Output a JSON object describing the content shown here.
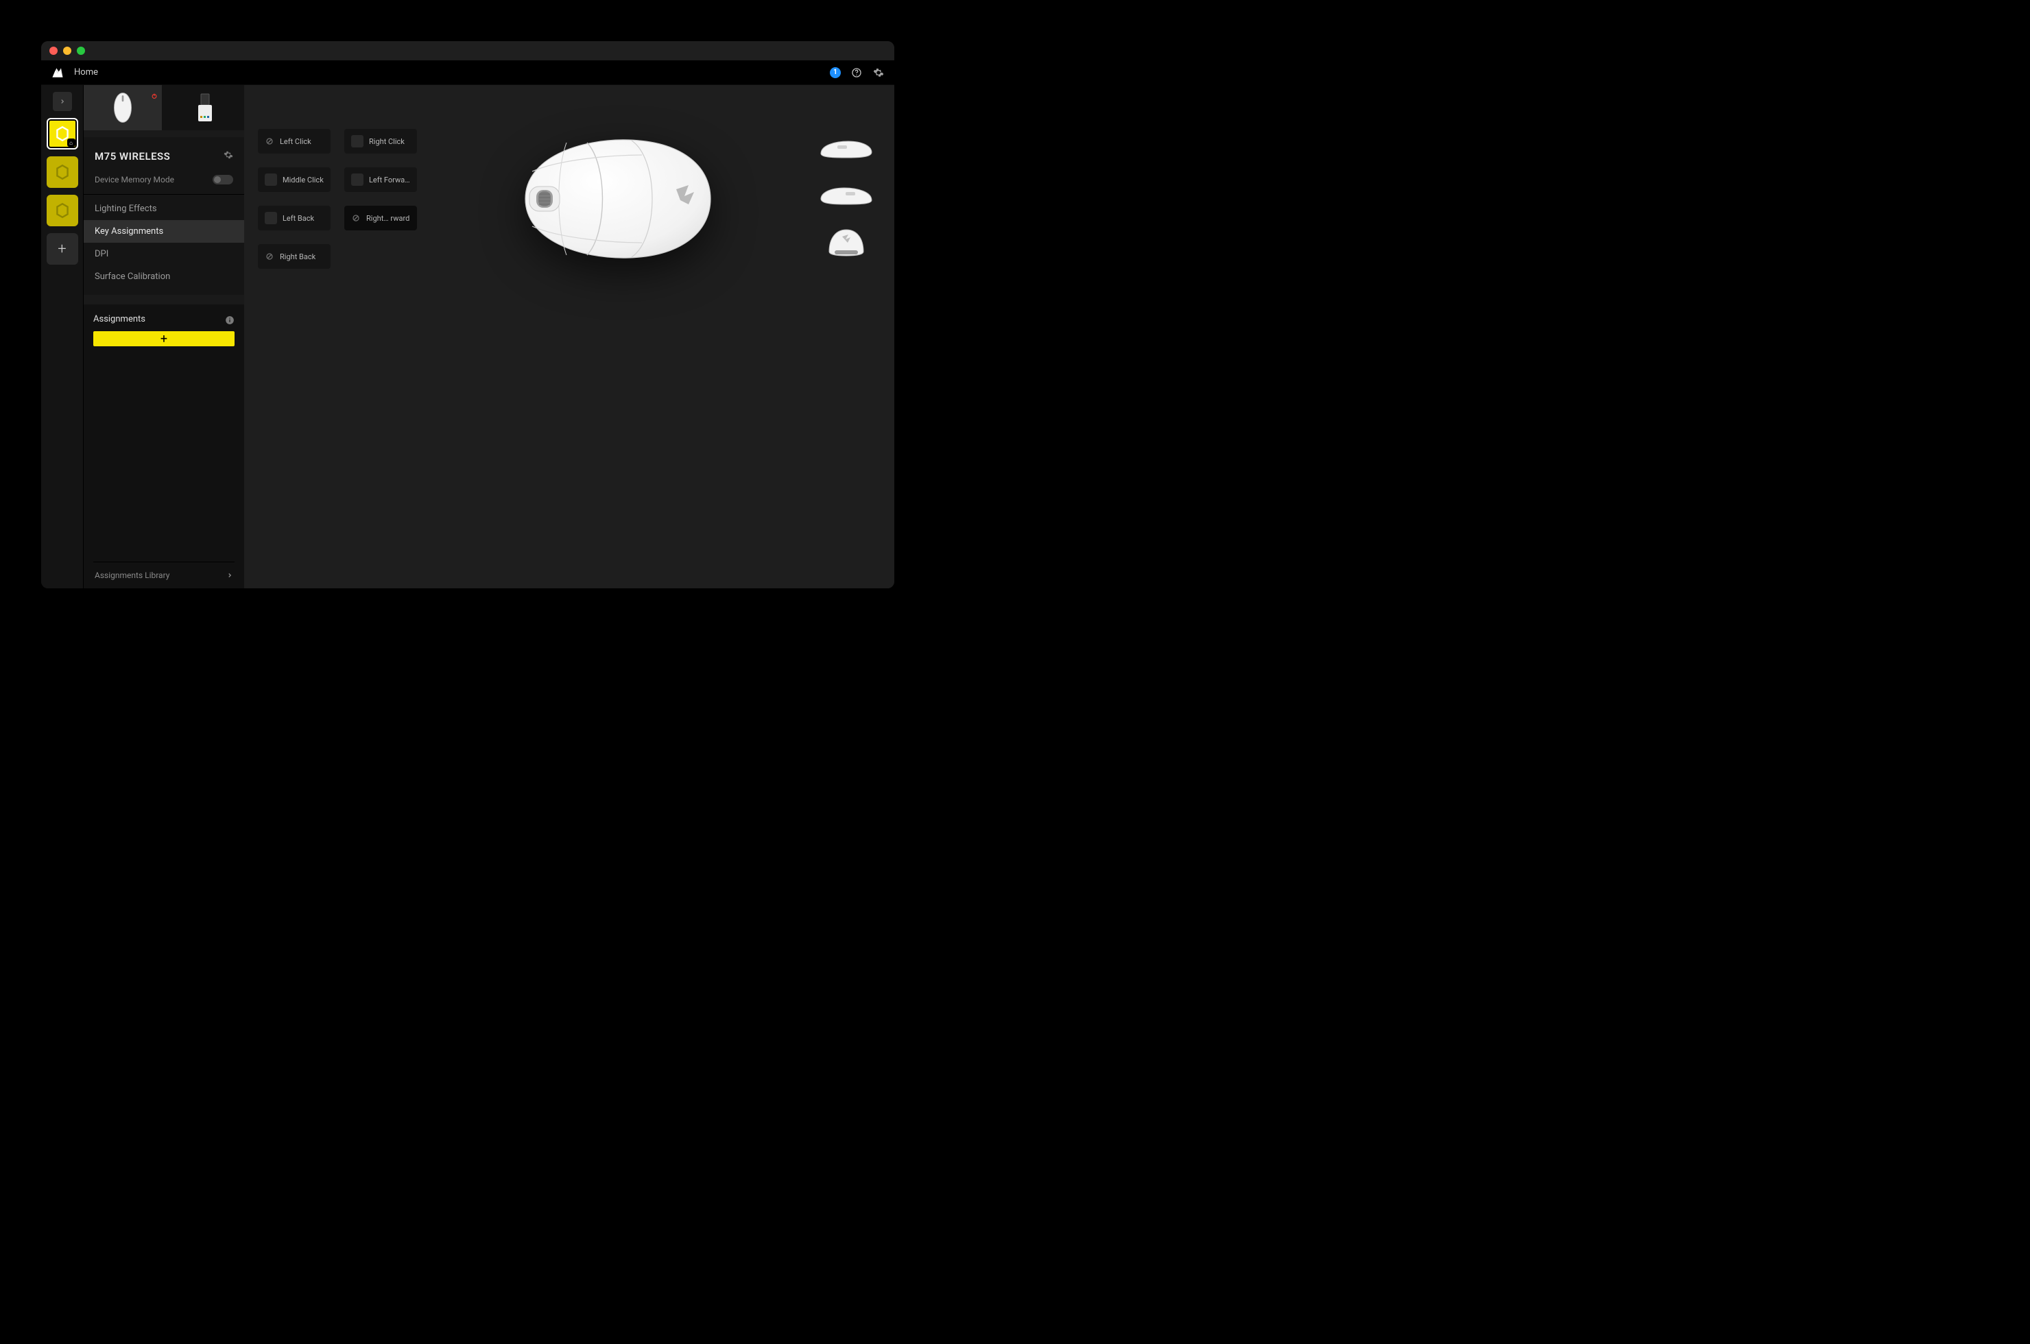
{
  "app": {
    "breadcrumb": "Home",
    "notification_count": "1"
  },
  "device": {
    "name": "M75 WIRELESS",
    "memory_mode_label": "Device Memory Mode"
  },
  "sidebar_nav": [
    {
      "label": "Lighting Effects"
    },
    {
      "label": "Key Assignments"
    },
    {
      "label": "DPI"
    },
    {
      "label": "Surface Calibration"
    }
  ],
  "assignments": {
    "title": "Assignments",
    "library_label": "Assignments Library"
  },
  "keys": {
    "left_click": "Left Click",
    "right_click": "Right Click",
    "middle_click": "Middle Click",
    "left_forward": "Left Forward",
    "left_back": "Left Back",
    "right_forward": "Right… rward",
    "right_back": "Right Back"
  }
}
